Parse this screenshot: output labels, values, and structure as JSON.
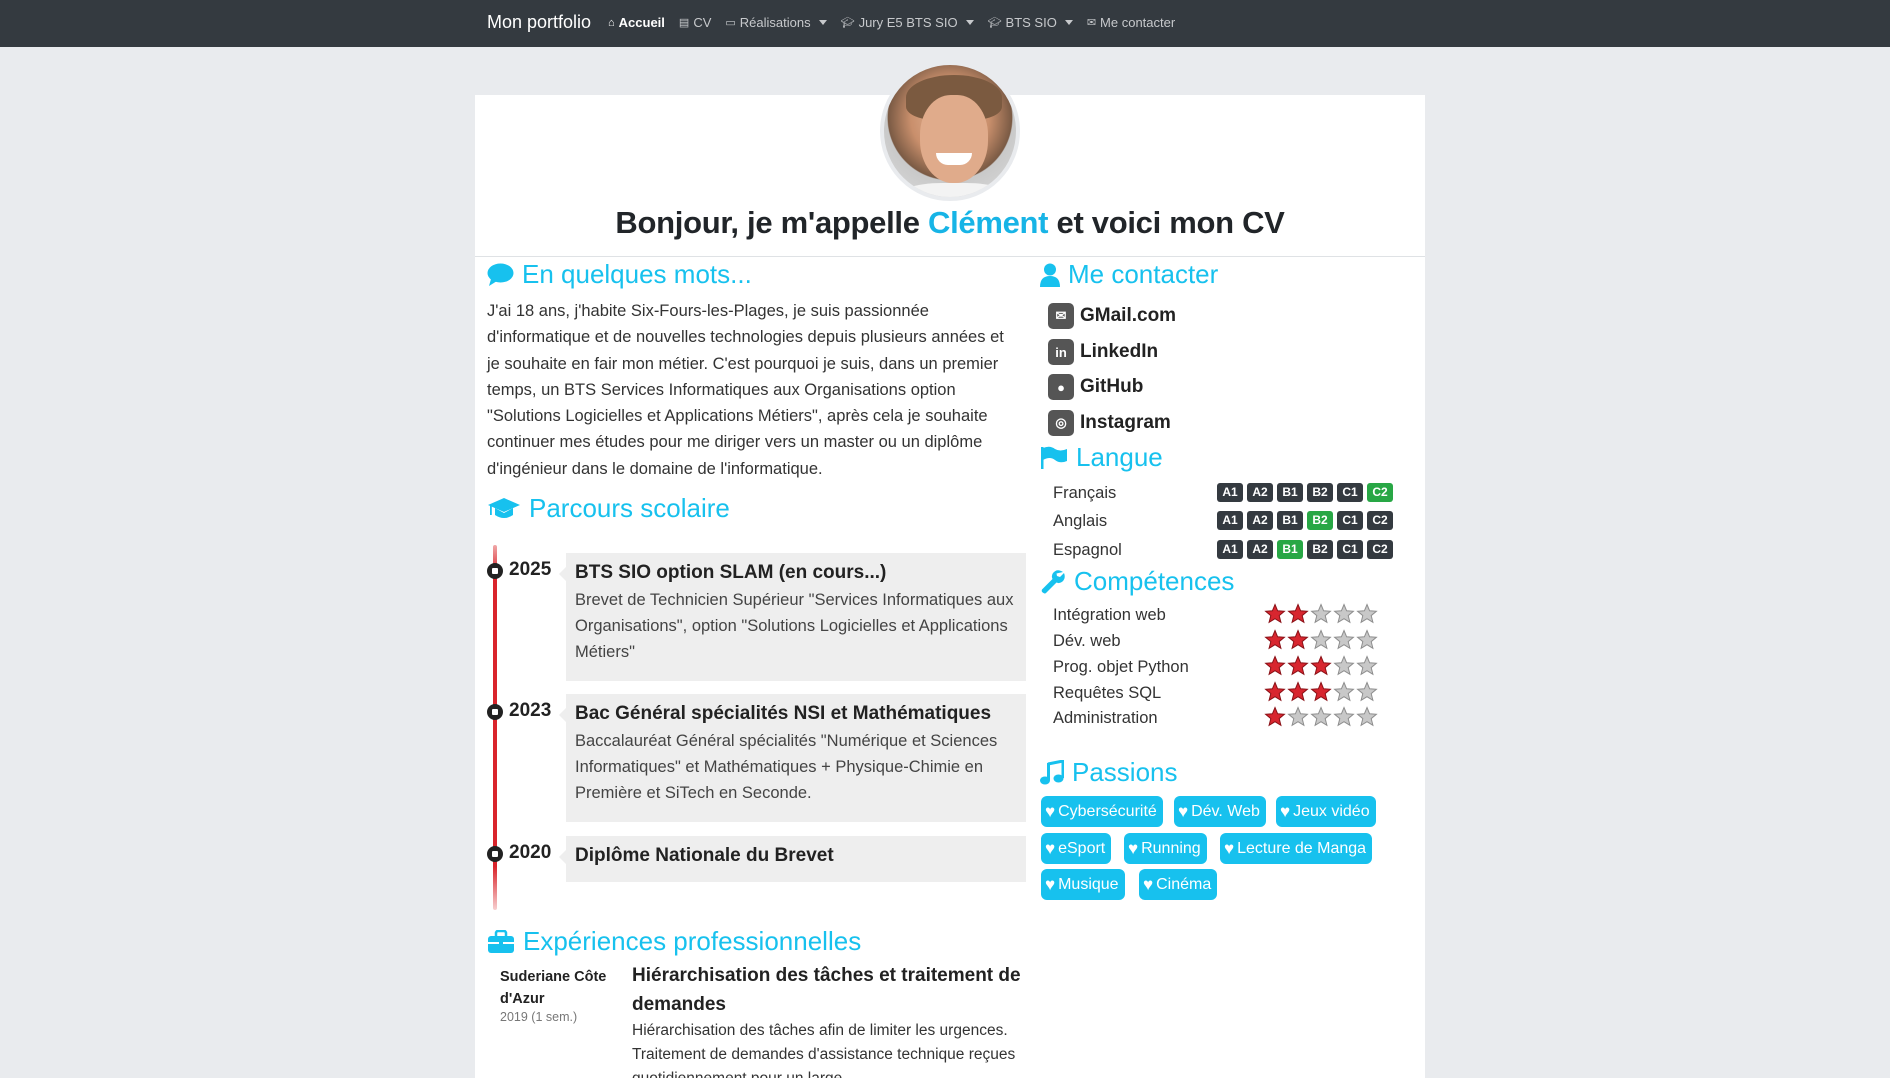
{
  "nav": {
    "brand": "Mon portfolio",
    "items": [
      {
        "label": "Accueil",
        "icon": "home-icon",
        "active": true,
        "dropdown": false
      },
      {
        "label": "CV",
        "icon": "document-icon",
        "active": false,
        "dropdown": false
      },
      {
        "label": "Réalisations",
        "icon": "window-icon",
        "active": false,
        "dropdown": true
      },
      {
        "label": "Jury E5 BTS SIO",
        "icon": "graduation-cap-icon",
        "active": false,
        "dropdown": true
      },
      {
        "label": "BTS SIO",
        "icon": "graduation-cap-icon",
        "active": false,
        "dropdown": true
      },
      {
        "label": "Me contacter",
        "icon": "envelope-icon",
        "active": false,
        "dropdown": false
      }
    ]
  },
  "hero": {
    "greeting_before": "Bonjour, je m'appelle ",
    "name": "Clément",
    "greeting_after": " et voici mon CV"
  },
  "about": {
    "title": "En quelques mots...",
    "text": "J'ai 18 ans, j'habite Six-Fours-les-Plages, je suis passionnée d'informatique et de nouvelles technologies depuis plusieurs années et je souhaite en fair mon métier. C'est pourquoi je suis, dans un premier temps, un BTS Services Informatiques aux Organisations option \"Solutions Logicielles et Applications Métiers\", après cela je souhaite continuer mes études pour me diriger vers un master ou un diplôme d'ingénieur dans le domaine de l'informatique."
  },
  "education": {
    "title": "Parcours scolaire",
    "items": [
      {
        "year": "2025",
        "title": "BTS SIO option SLAM (en cours...)",
        "desc": "Brevet de Technicien Supérieur \"Services Informatiques aux Organisations\", option \"Solutions Logicielles et Applications Métiers\""
      },
      {
        "year": "2023",
        "title": "Bac Général spécialités NSI et Mathématiques",
        "desc": "Baccalauréat Général spécialités \"Numérique et Sciences Informatiques\" et Mathématiques + Physique-Chimie en Première et SiTech en Seconde."
      },
      {
        "year": "2020",
        "title": "Diplôme Nationale du Brevet",
        "desc": ""
      }
    ]
  },
  "experience": {
    "title": "Expériences professionnelles",
    "company": "Suderiane Côte d'Azur",
    "date": "2019 (1 sem.)",
    "job_title": "Hiérarchisation des tâches et traitement de demandes",
    "desc": "Hiérarchisation des tâches afin de limiter les urgences. Traitement de demandes d'assistance technique reçues quotidiennement pour un large"
  },
  "contact": {
    "title": "Me contacter",
    "items": [
      {
        "label": "GMail.com",
        "icon": "mail-icon"
      },
      {
        "label": "LinkedIn",
        "icon": "linkedin-icon"
      },
      {
        "label": "GitHub",
        "icon": "github-icon"
      },
      {
        "label": "Instagram",
        "icon": "instagram-icon"
      }
    ]
  },
  "languages": {
    "title": "Langue",
    "levels": [
      "A1",
      "A2",
      "B1",
      "B2",
      "C1",
      "C2"
    ],
    "items": [
      {
        "name": "Français",
        "level": "C2"
      },
      {
        "name": "Anglais",
        "level": "B2"
      },
      {
        "name": "Espagnol",
        "level": "B1"
      }
    ]
  },
  "skills": {
    "title": "Compétences",
    "max_stars": 5,
    "items": [
      {
        "name": "Intégration web",
        "stars": 2
      },
      {
        "name": "Dév. web",
        "stars": 2
      },
      {
        "name": "Prog. objet Python",
        "stars": 3
      },
      {
        "name": "Requêtes SQL",
        "stars": 3
      },
      {
        "name": "Administration",
        "stars": 1
      }
    ]
  },
  "passions": {
    "title": "Passions",
    "items": [
      "Cybersécurité",
      "Dév. Web",
      "Jeux vidéo",
      "eSport",
      "Running",
      "Lecture de Manga",
      "Musique",
      "Cinéma"
    ]
  },
  "colors": {
    "accent": "#17c1ee",
    "navbar": "#343a40",
    "level_on": "#28a745",
    "timeline": "#d9242b"
  }
}
